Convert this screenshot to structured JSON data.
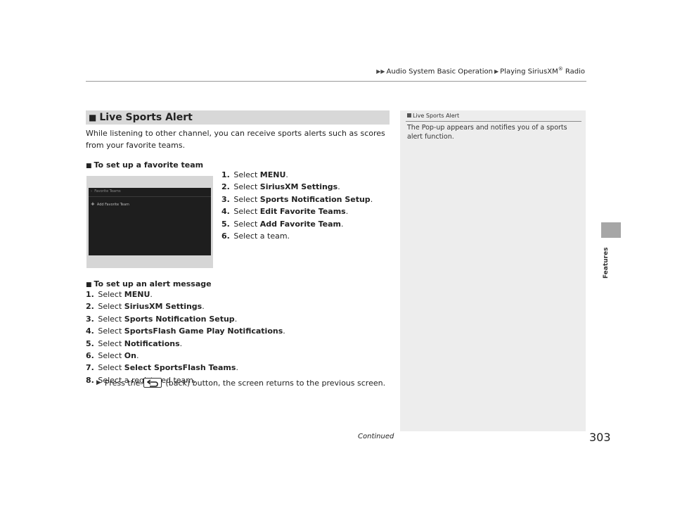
{
  "breadcrumb": {
    "level1": "Audio System Basic Operation",
    "level2": "Playing SiriusXM",
    "reg": "®",
    "level2_tail": " Radio"
  },
  "side_tab": {
    "label": "Features"
  },
  "section": {
    "marker": "■",
    "title": "Live Sports Alert"
  },
  "intro": "While listening to other channel, you can receive sports alerts such as scores from your favorite teams.",
  "favorite": {
    "marker": "■",
    "heading": "To set up a favorite team",
    "screen": {
      "header": "Favorite Teams",
      "item": "Add Favorite Team"
    },
    "steps": [
      {
        "num": "1.",
        "pre": "Select ",
        "bold": "MENU",
        "post": "."
      },
      {
        "num": "2.",
        "pre": "Select ",
        "bold": "SiriusXM Settings",
        "post": "."
      },
      {
        "num": "3.",
        "pre": "Select ",
        "bold": "Sports Notification Setup",
        "post": "."
      },
      {
        "num": "4.",
        "pre": "Select ",
        "bold": "Edit Favorite Teams",
        "post": "."
      },
      {
        "num": "5.",
        "pre": "Select ",
        "bold": "Add Favorite Team",
        "post": "."
      },
      {
        "num": "6.",
        "pre": "Select a team.",
        "bold": "",
        "post": ""
      }
    ]
  },
  "alert": {
    "marker": "■",
    "heading": "To set up an alert message",
    "steps": [
      {
        "num": "1.",
        "pre": "Select ",
        "bold": "MENU",
        "post": "."
      },
      {
        "num": "2.",
        "pre": "Select ",
        "bold": "SiriusXM Settings",
        "post": "."
      },
      {
        "num": "3.",
        "pre": "Select ",
        "bold": "Sports Notification Setup",
        "post": "."
      },
      {
        "num": "4.",
        "pre": "Select ",
        "bold": "SportsFlash Game Play Notifications",
        "post": "."
      },
      {
        "num": "5.",
        "pre": "Select ",
        "bold": "Notifications",
        "post": "."
      },
      {
        "num": "6.",
        "pre": "Select ",
        "bold": "On",
        "post": "."
      },
      {
        "num": "7.",
        "pre": "Select ",
        "bold": "Select SportsFlash Teams",
        "post": "."
      },
      {
        "num": "8.",
        "pre": "Select a registered team.",
        "bold": "",
        "post": ""
      }
    ],
    "note_pre": "Press the",
    "note_post": "(back) button, the screen returns to the previous screen."
  },
  "sidenote": {
    "heading": "Live Sports Alert",
    "body": "The Pop-up appears and notifies you of a sports alert function."
  },
  "footer": {
    "continued": "Continued",
    "page": "303"
  }
}
